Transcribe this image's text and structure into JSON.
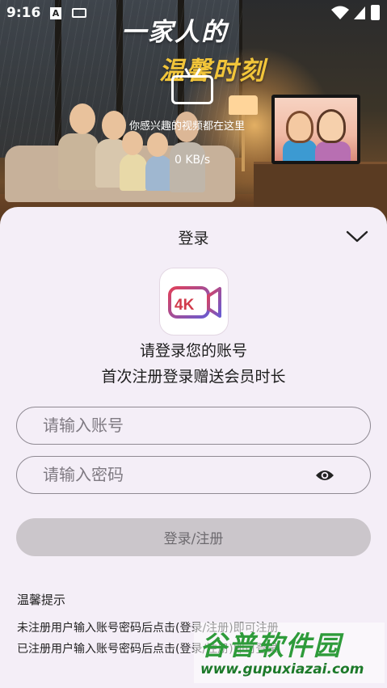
{
  "status_bar": {
    "time": "9:16",
    "icons": [
      "a-icon",
      "keyboard-icon",
      "wifi-icon",
      "signal-icon",
      "battery-icon"
    ]
  },
  "hero": {
    "title": "一家人的",
    "subtitle": "温馨时刻",
    "caption": "你感兴趣的视频都在这里",
    "speed": "0 KB/s"
  },
  "login": {
    "title": "登录",
    "prompt_line1": "请登录您的账号",
    "prompt_line2": "首次注册登录赠送会员时长",
    "account_placeholder": "请输入账号",
    "account_value": "",
    "password_placeholder": "请输入密码",
    "password_value": "",
    "submit_label": "登录/注册",
    "tips_title": "温馨提示",
    "tips": [
      "未注册用户输入账号密码后点击(登录/注册)即可注册",
      "已注册用户输入账号密码后点击(登录/注册)即可登录"
    ],
    "logo_text": "4K"
  },
  "watermark": {
    "name": "谷普软件园",
    "url": "www.gupuxiazai.com"
  },
  "colors": {
    "sheet_bg": "#f4eef7",
    "button_disabled": "#cbc6cb",
    "logo_red": "#d13a4a",
    "logo_purple": "#7b56c4",
    "watermark_green": "#2e9b3a"
  }
}
